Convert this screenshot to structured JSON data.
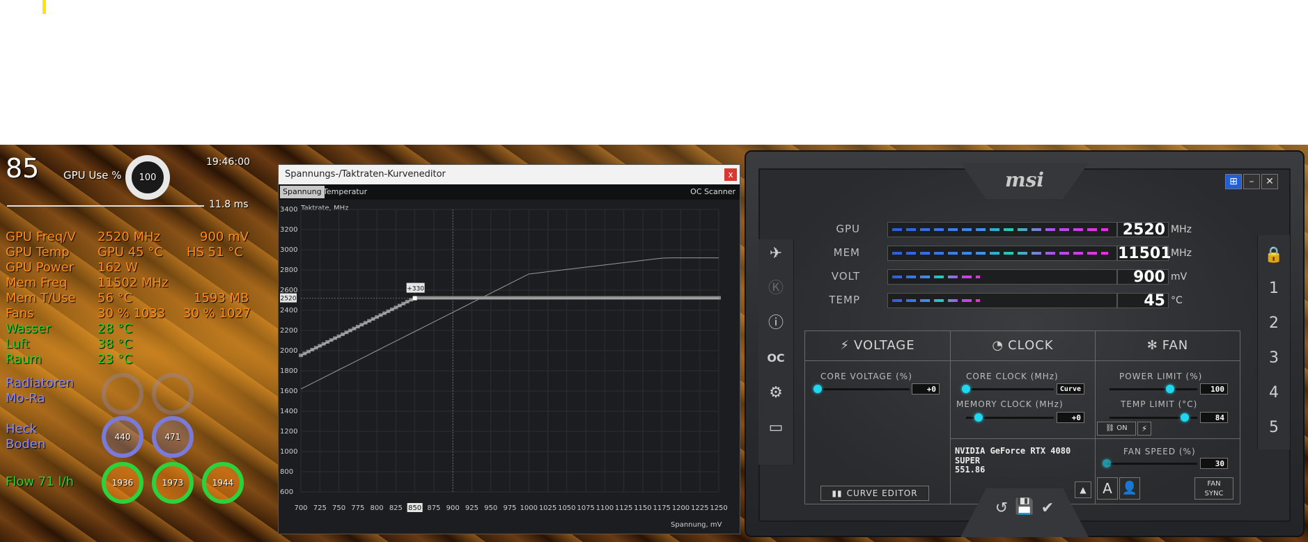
{
  "osd": {
    "fps": "85",
    "gpu_use_label": "GPU Use %",
    "gpu_use_value": "100",
    "clock": "19:46:00",
    "frametime": "11.8 ms",
    "rows": [
      {
        "label": "GPU Freq/V",
        "v1": "2520 MHz",
        "v2": "900 mV"
      },
      {
        "label": "GPU Temp",
        "v1": "GPU 45 °C",
        "v2": "HS 51 °C"
      },
      {
        "label": "GPU Power",
        "v1": "162 W",
        "v2": ""
      },
      {
        "label": "Mem Freq",
        "v1": "11502 MHz",
        "v2": ""
      },
      {
        "label": "Mem T/Use",
        "v1": "56 °C",
        "v2": "1593 MB"
      },
      {
        "label": "Fans",
        "v1": "30 %  1033",
        "v2": "30 % 1027"
      }
    ],
    "temps": [
      {
        "label": "Wasser",
        "value": "28 °C"
      },
      {
        "label": "Luft",
        "value": "38 °C"
      },
      {
        "label": "Raum",
        "value": "23 °C"
      }
    ],
    "radiatoren_label": "Radiatoren",
    "mora_label": "Mo-Ra",
    "heck_label": "Heck",
    "boden_label": "Boden",
    "heck_value": "440",
    "boden_value": "471",
    "flow_label": "Flow 71 l/h",
    "flow_values": [
      "1936",
      "1973",
      "1944"
    ]
  },
  "editor": {
    "title": "Spannungs-/Taktraten-Kurveneditor",
    "close": "x",
    "tabs": [
      "Spannung",
      "Temperatur"
    ],
    "oc_scanner": "OC Scanner",
    "y_axis_label": "Taktrate, MHz",
    "x_axis_label": "Spannung, mV",
    "offset_label": "+330",
    "current_clock_label": "2520",
    "selected_voltage": "850",
    "y_ticks": [
      "600",
      "800",
      "1000",
      "1200",
      "1400",
      "1600",
      "1800",
      "2000",
      "2200",
      "2400",
      "2600",
      "2800",
      "3000",
      "3200",
      "3400"
    ],
    "x_ticks": [
      "700",
      "725",
      "750",
      "775",
      "800",
      "825",
      "850",
      "875",
      "900",
      "925",
      "950",
      "975",
      "1000",
      "1025",
      "1050",
      "1075",
      "1100",
      "1125",
      "1150",
      "1175",
      "1200",
      "1225",
      "1250"
    ]
  },
  "msi": {
    "logo": "msi",
    "meters": [
      {
        "label": "GPU",
        "value": "2520",
        "unit": "MHz",
        "fill": 0.98
      },
      {
        "label": "MEM",
        "value": "11501",
        "unit": "MHz",
        "fill": 0.98
      },
      {
        "label": "VOLT",
        "value": "900",
        "unit": "mV",
        "fill": 0.4
      },
      {
        "label": "TEMP",
        "value": "45",
        "unit": "°C",
        "fill": 0.4
      }
    ],
    "voltage_header": "VOLTAGE",
    "clock_header": "CLOCK",
    "fan_header": "FAN",
    "core_voltage_label": "CORE VOLTAGE  (%)",
    "core_voltage_value": "+0",
    "core_clock_label": "CORE CLOCK (MHz)",
    "core_clock_value": "Curve",
    "memory_clock_label": "MEMORY CLOCK (MHz)",
    "memory_clock_value": "+0",
    "power_limit_label": "POWER LIMIT (%)",
    "power_limit_value": "100",
    "temp_limit_label": "TEMP LIMIT (°C)",
    "temp_limit_value": "84",
    "link_on": "ON",
    "gpu_name": "NVIDIA GeForce RTX 4080 SUPER",
    "driver": "551.86",
    "fan_speed_label": "FAN SPEED (%)",
    "fan_speed_value": "30",
    "curve_editor": "CURVE EDITOR",
    "fan_sync": "FAN\nSYNC",
    "profiles": [
      "1",
      "2",
      "3",
      "4",
      "5"
    ],
    "auto_label": "A"
  }
}
